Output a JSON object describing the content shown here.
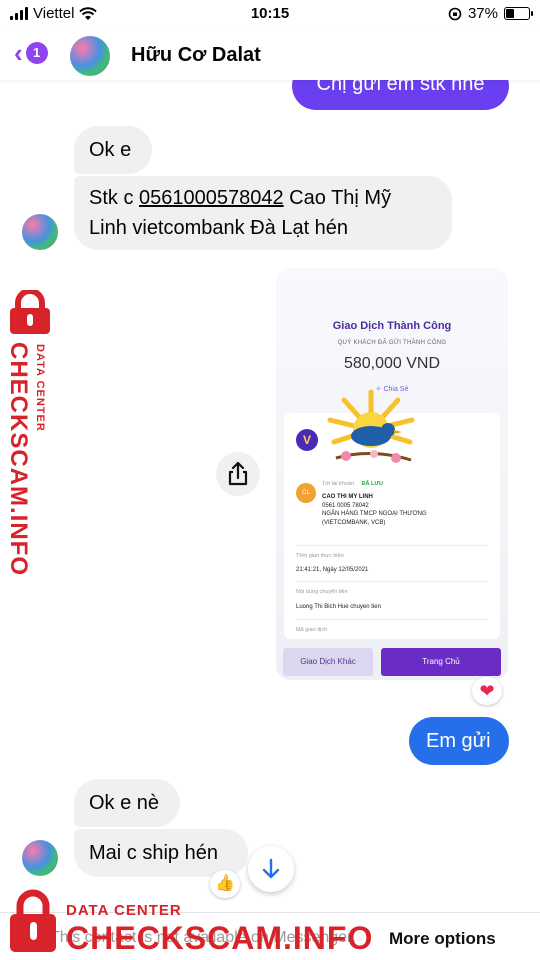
{
  "status": {
    "carrier": "Viettel",
    "time": "10:15",
    "battery": "37%"
  },
  "header": {
    "unread_count": "1",
    "contact_name": "Hữu Cơ Dalat"
  },
  "messages": {
    "m1": "Chị gửi em stk nhé",
    "m2": "Ok e",
    "m3_prefix": "Stk c ",
    "m3_account": "0561000578042",
    "m3_mid": " Cao Thị Mỹ",
    "m3_line2": "Linh vietcombank Đà Lạt hén",
    "m4": "Em gửi",
    "m5": "Ok e nè",
    "m6": "Mai c ship hén"
  },
  "receipt": {
    "title": "Giao Dịch Thành Công",
    "subtitle": "QUÝ KHÁCH ĐÃ GỬI THÀNH CÔNG",
    "amount": "580,000 VND",
    "share": "Chia Sẻ",
    "account_label": "Tới tài khoản",
    "saved": "ĐÃ LƯU",
    "initials": "CL",
    "name": "CAO THI MY LINH",
    "account": "0561 0005 78042",
    "bank_line1": "NGÂN HÀNG TMCP NGOẠI THƯƠNG",
    "bank_line2": "(VIETCOMBANK, VCB)",
    "time_label": "Thời gian thực hiện",
    "time_value": "21:41:21, Ngày 12/05/2021",
    "content_label": "Nội dung chuyển tiền",
    "content_value": "Luong Thi Bich Hue chuyen tien",
    "code_label": "Mã giao dịch",
    "btn_other": "Giao Dịch Khác",
    "btn_home": "Trang Chủ"
  },
  "reactions": {
    "heart": "❤",
    "like": "👍"
  },
  "footer": {
    "banner_text": "This contact is not available on Messenger.",
    "more_options": "More options"
  },
  "watermark": {
    "line1": "DATA CENTER",
    "line2": "CHECKSCAM.INFO"
  },
  "colors": {
    "accent": "#8e44ef",
    "outgoing": "#6b3ff0",
    "outgoing_blue": "#2570ea",
    "incoming": "#f0f0f0",
    "watermark": "#d8232a"
  }
}
